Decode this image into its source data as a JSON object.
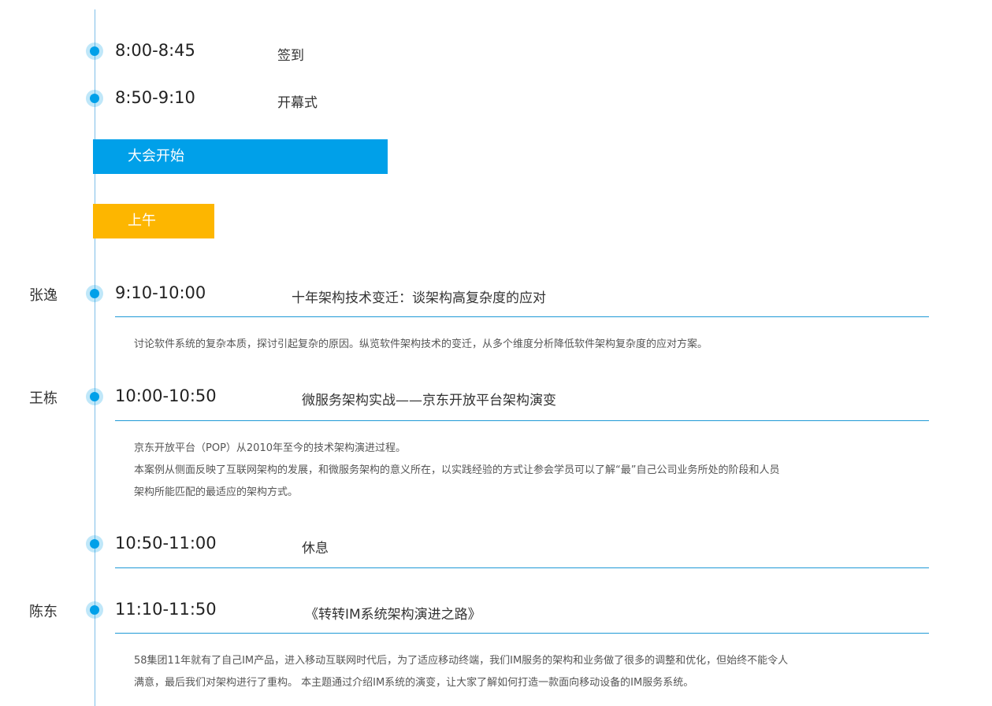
{
  "colors": {
    "accent_blue": "#00a0e9",
    "accent_yellow": "#fdb600",
    "line": "#1f9ad6"
  },
  "schedule": [
    {
      "time": "8:00-8:45",
      "title": "签到"
    },
    {
      "time": "8:50-9:10",
      "title": "开幕式"
    }
  ],
  "banners": {
    "main": "大会开始",
    "morning": "上午"
  },
  "sessions": [
    {
      "speaker": "张逸",
      "time": "9:10-10:00",
      "title": "十年架构技术变迁：谈架构高复杂度的应对",
      "desc": [
        "讨论软件系统的复杂本质，探讨引起复杂的原因。纵览软件架构技术的变迁，从多个维度分析降低软件架构复杂度的应对方案。"
      ]
    },
    {
      "speaker": "王栋",
      "time": "10:00-10:50",
      "title": "微服务架构实战——京东开放平台架构演变",
      "desc": [
        "京东开放平台（POP）从2010年至今的技术架构演进过程。",
        "本案例从侧面反映了互联网架构的发展，和微服务架构的意义所在，以实践经验的方式让参会学员可以了解“最”自己公司业务所处的阶段和人员",
        "架构所能匹配的最适应的架构方式。"
      ]
    },
    {
      "speaker": "",
      "time": "10:50-11:00",
      "title": "休息",
      "desc": []
    },
    {
      "speaker": "陈东",
      "time": "11:10-11:50",
      "title": "《转转IM系统架构演进之路》",
      "desc": [
        "58集团11年就有了自己IM产品，进入移动互联网时代后，为了适应移动终端，我们IM服务的架构和业务做了很多的调整和优化，但始终不能令人",
        "满意，最后我们对架构进行了重构。 本主题通过介绍IM系统的演变，让大家了解如何打造一款面向移动设备的IM服务系统。"
      ]
    }
  ]
}
